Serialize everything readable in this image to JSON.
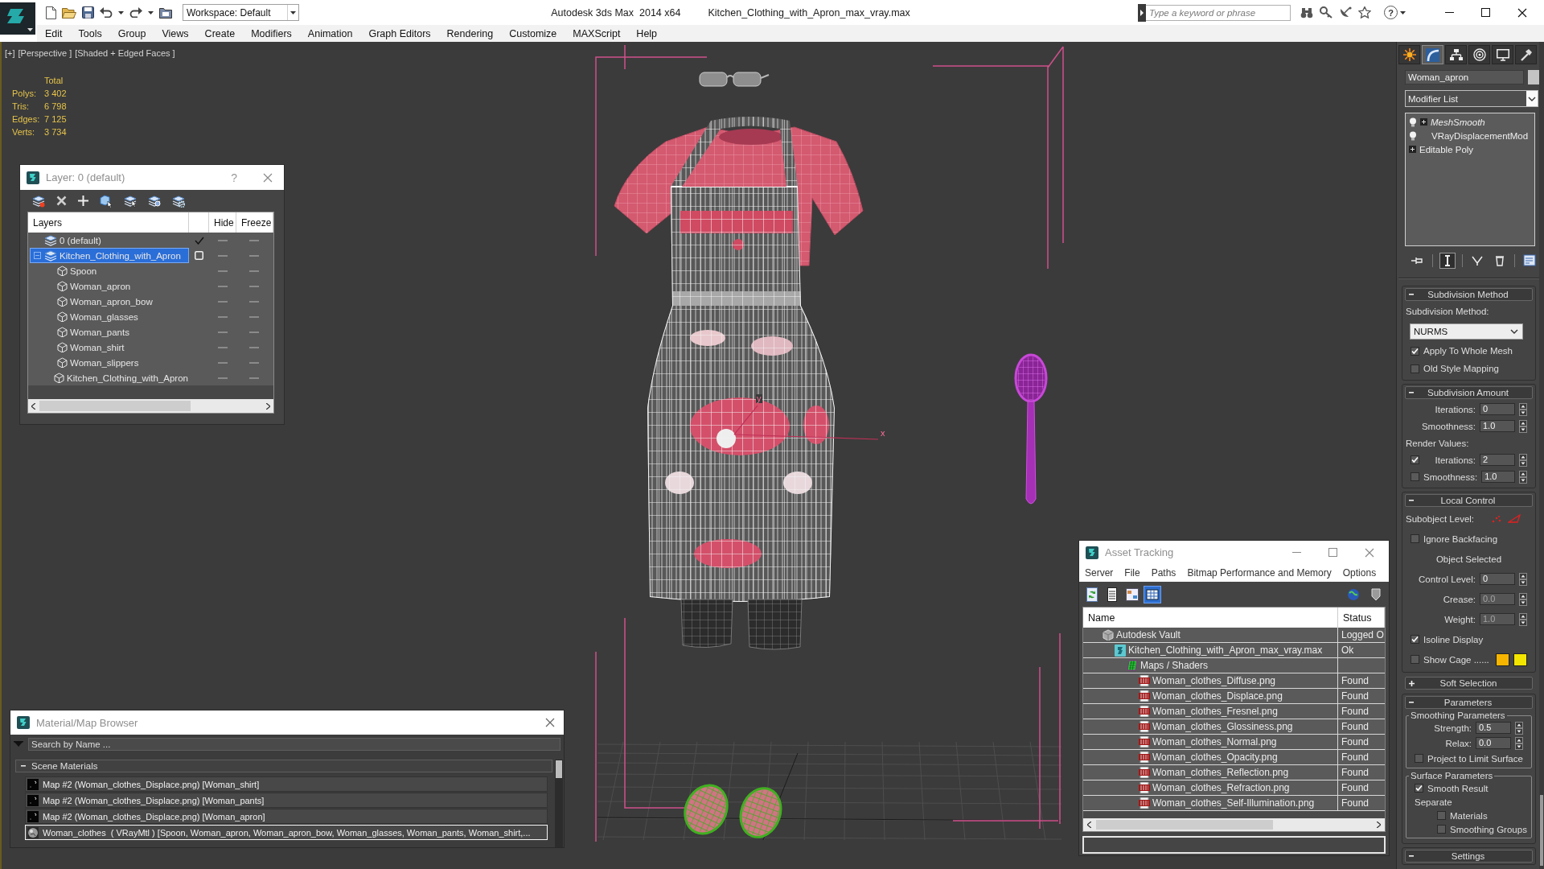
{
  "title_bar": {
    "workspace": "Workspace: Default",
    "app_title": "Autodesk 3ds Max  2014 x64",
    "document_title": "Kitchen_Clothing_with_Apron_max_vray.max",
    "search": {
      "placeholder": "Type a keyword or phrase"
    },
    "help": "?"
  },
  "menu_bar": [
    "Edit",
    "Tools",
    "Group",
    "Views",
    "Create",
    "Modifiers",
    "Animation",
    "Graph Editors",
    "Rendering",
    "Customize",
    "MAXScript",
    "Help"
  ],
  "viewport": {
    "labels": [
      "[+]",
      "[Perspective ]",
      "[Shaded + Edged Faces ]"
    ],
    "stats": {
      "heading": "Total",
      "rows": [
        {
          "label": "Polys:",
          "value": "3 402"
        },
        {
          "label": "Tris:",
          "value": "6 798"
        },
        {
          "label": "Edges:",
          "value": "7 125"
        },
        {
          "label": "Verts:",
          "value": "3 734"
        }
      ]
    },
    "axis_labels": [
      "x",
      "y"
    ]
  },
  "layer_dialog": {
    "title": "Layer: 0 (default)",
    "help": "?",
    "columns": [
      "Layers",
      "Hide",
      "Freeze"
    ],
    "layers": [
      {
        "name": "0 (default)",
        "selected": false,
        "current": true,
        "hidden": false,
        "frozen": false
      },
      {
        "name": "Kitchen_Clothing_with_Apron",
        "selected": true,
        "current": false,
        "expanded": true,
        "hidden": false,
        "frozen": false,
        "children": [
          {
            "name": "Spoon",
            "selected": false,
            "hidden": false,
            "frozen": false
          },
          {
            "name": "Woman_apron",
            "selected": false,
            "hidden": false,
            "frozen": false
          },
          {
            "name": "Woman_apron_bow",
            "selected": false,
            "hidden": false,
            "frozen": false
          },
          {
            "name": "Woman_glasses",
            "selected": false,
            "hidden": false,
            "frozen": false
          },
          {
            "name": "Woman_pants",
            "selected": false,
            "hidden": false,
            "frozen": false
          },
          {
            "name": "Woman_shirt",
            "selected": false,
            "hidden": false,
            "frozen": false
          },
          {
            "name": "Woman_slippers",
            "selected": false,
            "hidden": false,
            "frozen": false
          },
          {
            "name": "Kitchen_Clothing_with_Apron",
            "selected": false,
            "hidden": false,
            "frozen": false
          }
        ]
      }
    ]
  },
  "material_browser": {
    "title": "Material/Map Browser",
    "search": {
      "placeholder": "Search by Name ..."
    },
    "groups": [
      {
        "title": "Scene Materials",
        "expanded": true,
        "items": [
          {
            "kind": "map",
            "label": "Map #2 (Woman_clothes_Displace.png) [Woman_shirt]",
            "selected": false
          },
          {
            "kind": "map",
            "label": "Map #2 (Woman_clothes_Displace.png) [Woman_pants]",
            "selected": false
          },
          {
            "kind": "map",
            "label": "Map #2 (Woman_clothes_Displace.png) [Woman_apron]",
            "selected": false
          },
          {
            "kind": "material",
            "label": "Woman_clothes  ( VRayMtl ) [Spoon, Woman_apron, Woman_apron_bow, Woman_glasses, Woman_pants, Woman_shirt,...",
            "selected": true
          }
        ]
      }
    ]
  },
  "asset_tracking": {
    "title": "Asset Tracking",
    "menu": [
      "Server",
      "File",
      "Paths",
      "Bitmap Performance and Memory",
      "Options"
    ],
    "toolbar": [
      {
        "kind": "refresh",
        "selected": false
      },
      {
        "kind": "list",
        "selected": false
      },
      {
        "kind": "thumbnails",
        "selected": false
      },
      {
        "kind": "table",
        "selected": true
      }
    ],
    "columns": [
      "Name",
      "Status"
    ],
    "assets": [
      {
        "kind": "vault",
        "name": "Autodesk Vault",
        "status": "Logged O",
        "children": [
          {
            "kind": "scene",
            "name": "Kitchen_Clothing_with_Apron_max_vray.max",
            "status": "Ok",
            "children": [
              {
                "kind": "folder",
                "name": "Maps / Shaders",
                "children": [
                  {
                    "kind": "image",
                    "name": "Woman_clothes_Diffuse.png",
                    "status": "Found"
                  },
                  {
                    "kind": "image",
                    "name": "Woman_clothes_Displace.png",
                    "status": "Found"
                  },
                  {
                    "kind": "image",
                    "name": "Woman_clothes_Fresnel.png",
                    "status": "Found"
                  },
                  {
                    "kind": "image",
                    "name": "Woman_clothes_Glossiness.png",
                    "status": "Found"
                  },
                  {
                    "kind": "image",
                    "name": "Woman_clothes_Normal.png",
                    "status": "Found"
                  },
                  {
                    "kind": "image",
                    "name": "Woman_clothes_Opacity.png",
                    "status": "Found"
                  },
                  {
                    "kind": "image",
                    "name": "Woman_clothes_Reflection.png",
                    "status": "Found"
                  },
                  {
                    "kind": "image",
                    "name": "Woman_clothes_Refraction.png",
                    "status": "Found"
                  },
                  {
                    "kind": "image",
                    "name": "Woman_clothes_Self-Illumination.png",
                    "status": "Found"
                  }
                ]
              }
            ]
          }
        ]
      }
    ]
  },
  "command_panel": {
    "tabs": [
      {
        "kind": "create",
        "selected": false
      },
      {
        "kind": "modify",
        "selected": true
      },
      {
        "kind": "hierarchy",
        "selected": false
      },
      {
        "kind": "motion",
        "selected": false
      },
      {
        "kind": "display",
        "selected": false
      },
      {
        "kind": "utilities",
        "selected": false
      }
    ],
    "object_name": "Woman_apron",
    "modifier_list": "Modifier List",
    "stack": [
      {
        "kind": "modifier",
        "name": "MeshSmooth",
        "off_in_viewport": true,
        "expandable": true
      },
      {
        "kind": "modifier",
        "name": "VRayDisplacementMod",
        "off_in_viewport": false,
        "expandable": false
      },
      {
        "kind": "base",
        "name": "Editable Poly",
        "off_in_viewport": false,
        "expandable": true
      }
    ],
    "stack_tools": [
      {
        "kind": "pin",
        "selected": false
      },
      {
        "kind": "result",
        "selected": true
      },
      {
        "kind": "unique",
        "selected": false
      },
      {
        "kind": "remove",
        "selected": false
      },
      {
        "kind": "sets",
        "selected": false
      }
    ],
    "rollouts": [
      {
        "title": "Subdivision Method",
        "expanded": true,
        "controls": [
          {
            "kind": "label",
            "text": "Subdivision Method:"
          },
          {
            "kind": "dropdown",
            "value": "NURMS"
          },
          {
            "kind": "checkbox",
            "label": "Apply To Whole Mesh",
            "checked": true
          },
          {
            "kind": "checkbox",
            "label": "Old Style Mapping",
            "checked": false
          }
        ]
      },
      {
        "title": "Subdivision Amount",
        "expanded": true,
        "controls": [
          {
            "kind": "spinner",
            "label": "Iterations:",
            "value": "0",
            "disabled": false
          },
          {
            "kind": "spinner",
            "label": "Smoothness:",
            "value": "1.0",
            "disabled": false
          },
          {
            "kind": "label",
            "text": "Render Values:"
          },
          {
            "kind": "checkspinner",
            "label": "Iterations:",
            "value": "2",
            "checked": true,
            "disabled": false
          },
          {
            "kind": "checkspinner",
            "label": "Smoothness:",
            "value": "1.0",
            "checked": false,
            "disabled": false
          }
        ]
      },
      {
        "title": "Local Control",
        "expanded": true,
        "controls": [
          {
            "kind": "subobject",
            "label": "Subobject Level:"
          },
          {
            "kind": "checkbox",
            "label": "Ignore Backfacing",
            "checked": false
          },
          {
            "kind": "status",
            "text": "Object Selected"
          },
          {
            "kind": "spinner",
            "label": "Control Level:",
            "value": "0",
            "disabled": false
          },
          {
            "kind": "spinner",
            "label": "Crease:",
            "value": "0.0",
            "disabled": true
          },
          {
            "kind": "spinner",
            "label": "Weight:",
            "value": "1.0",
            "disabled": true
          },
          {
            "kind": "checkbox",
            "label": "Isoline Display",
            "checked": true
          },
          {
            "kind": "cage",
            "label": "Show Cage ......",
            "checked": false,
            "swatches": [
              {
                "color": "#f7b500"
              },
              {
                "color": "#f3e500"
              }
            ]
          }
        ]
      },
      {
        "title": "Soft Selection",
        "expanded": false
      },
      {
        "title": "Parameters",
        "expanded": true,
        "controls": [
          {
            "kind": "group",
            "title": "Smoothing Parameters",
            "controls": [
              {
                "kind": "spinner",
                "label": "Strength:",
                "value": "0.5",
                "disabled": false
              },
              {
                "kind": "spinner",
                "label": "Relax:",
                "value": "0.0",
                "disabled": false
              },
              {
                "kind": "checkbox",
                "label": "Project to Limit Surface",
                "checked": false
              }
            ]
          },
          {
            "kind": "group",
            "title": "Surface Parameters",
            "controls": [
              {
                "kind": "checkbox",
                "label": "Smooth Result",
                "checked": true
              },
              {
                "kind": "section",
                "title": "Separate",
                "controls": [
                  {
                    "kind": "checkbox",
                    "label": "Materials",
                    "checked": false
                  },
                  {
                    "kind": "checkbox",
                    "label": "Smoothing Groups",
                    "checked": false
                  }
                ]
              }
            ]
          }
        ]
      },
      {
        "title": "Settings",
        "expanded": true
      }
    ]
  }
}
